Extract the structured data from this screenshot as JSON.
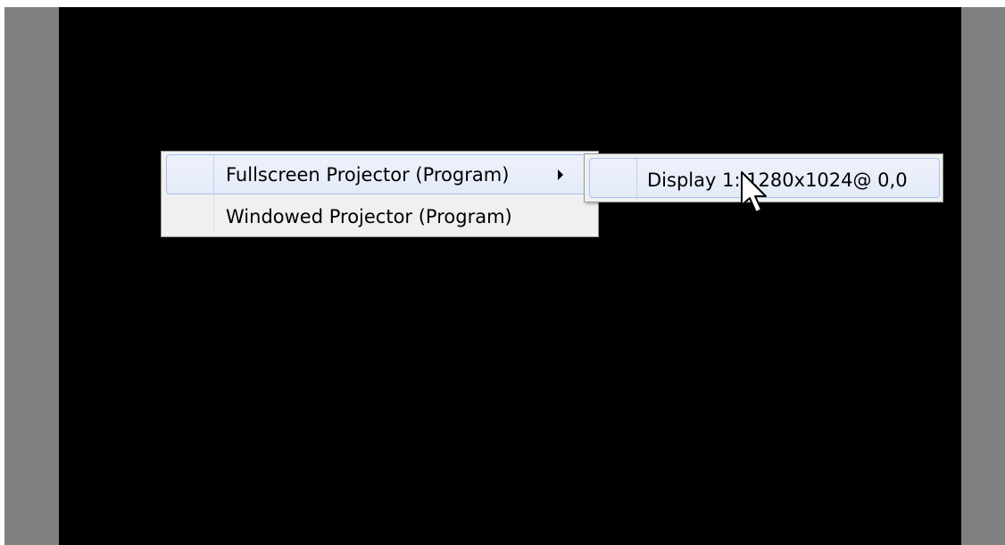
{
  "context_menu": {
    "items": [
      {
        "label": "Fullscreen Projector (Program)",
        "has_submenu": true,
        "highlighted": true
      },
      {
        "label": "Windowed Projector (Program)",
        "has_submenu": false,
        "highlighted": false
      }
    ]
  },
  "submenu": {
    "items": [
      {
        "label": "Display 1: 1280x1024@ 0,0",
        "highlighted": true
      }
    ]
  },
  "colors": {
    "canvas": "#000000",
    "pillarbox": "#808080",
    "menu_background": "#f0f0f0",
    "menu_border": "#979797",
    "highlight_border": "#a8c2ec",
    "highlight_fill": "#e8eefa"
  },
  "icons": {
    "submenu_arrow": "chevron-right-icon",
    "mouse_pointer": "arrow-cursor-icon"
  }
}
